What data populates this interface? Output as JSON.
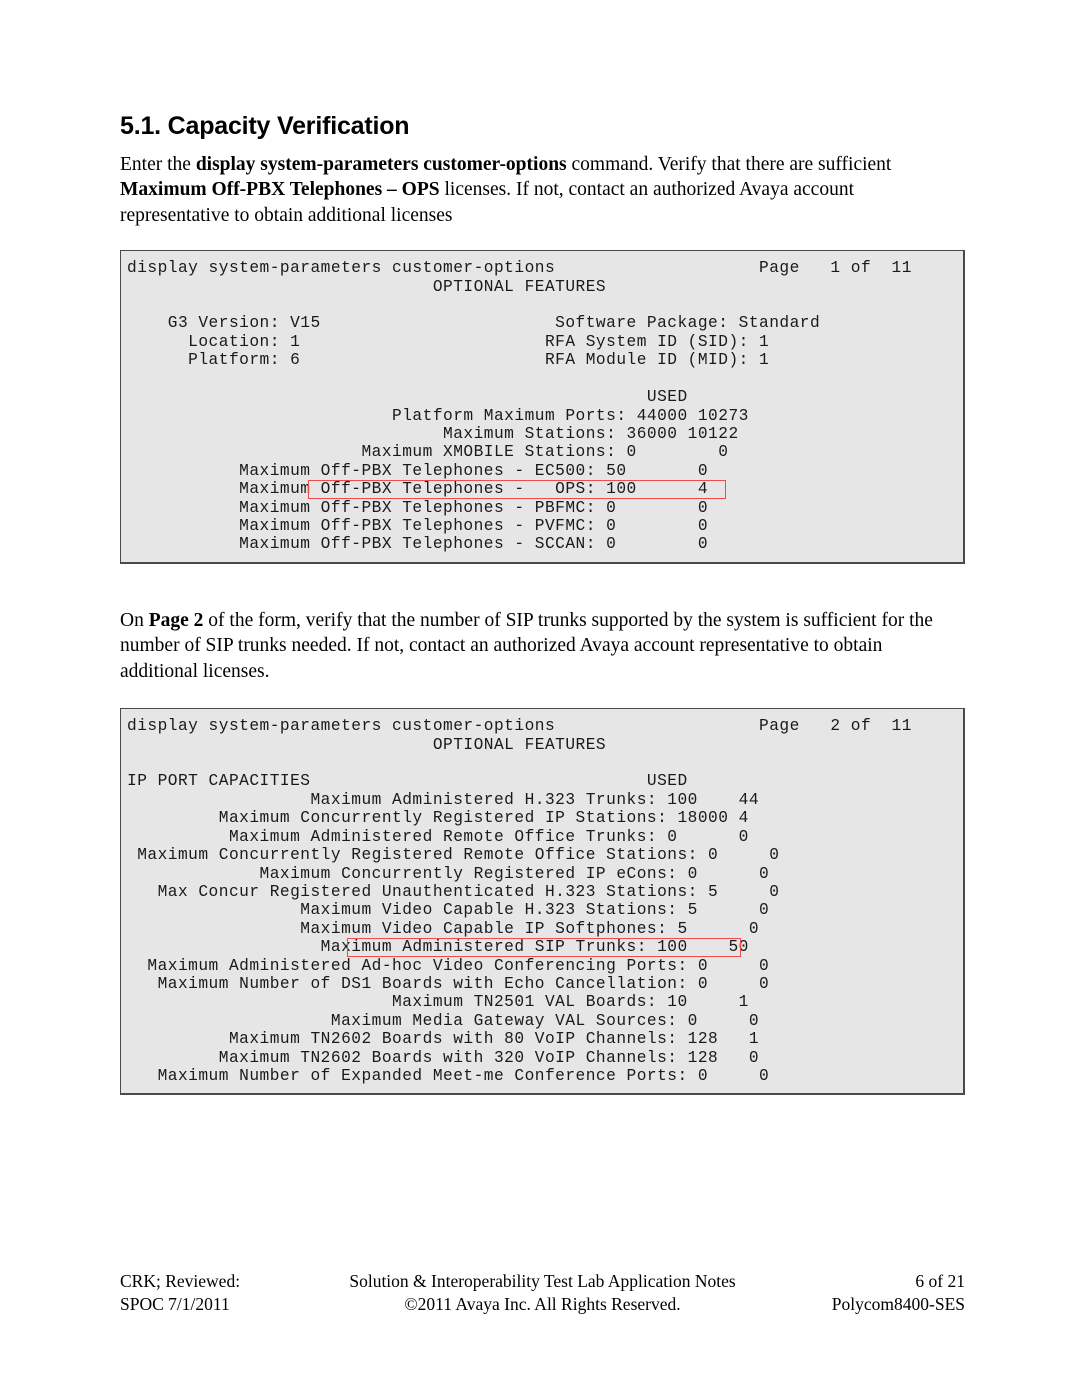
{
  "section": {
    "heading": "5.1. Capacity Verification",
    "paragraph1": {
      "segments": [
        {
          "text": "Enter the ",
          "bold": false
        },
        {
          "text": "display system-parameters customer-options",
          "bold": true
        },
        {
          "text": " command. Verify that there are sufficient ",
          "bold": false
        },
        {
          "text": "Maximum Off-PBX Telephones – OPS",
          "bold": true
        },
        {
          "text": " licenses. If not, contact an authorized Avaya account representative to obtain additional licenses",
          "bold": false
        }
      ]
    },
    "paragraph2": {
      "segments": [
        {
          "text": "On ",
          "bold": false
        },
        {
          "text": "Page 2",
          "bold": true
        },
        {
          "text": " of the form, verify that the number of SIP trunks supported by the system is sufficient for the number of SIP trunks needed. If not, contact an authorized Avaya account representative to obtain additional licenses.",
          "bold": false
        }
      ]
    }
  },
  "terminal1": {
    "name": "system-parameters-customer-options-page-1",
    "highlight_color": "#ee4b4b",
    "background": "#e6e6e6",
    "lines": [
      {
        "text": "display system-parameters customer-options                    Page   1 of  11",
        "boxed": false
      },
      {
        "text": "                              OPTIONAL FEATURES",
        "boxed": false
      },
      {
        "text": "",
        "boxed": false
      },
      {
        "text": "    G3 Version: V15                       Software Package: Standard",
        "boxed": false
      },
      {
        "text": "      Location: 1                        RFA System ID (SID): 1",
        "boxed": false
      },
      {
        "text": "      Platform: 6                        RFA Module ID (MID): 1",
        "boxed": false
      },
      {
        "text": "",
        "boxed": false
      },
      {
        "text": "                                                   USED",
        "boxed": false
      },
      {
        "text": "                          Platform Maximum Ports: 44000 10273",
        "boxed": false
      },
      {
        "text": "                               Maximum Stations: 36000 10122",
        "boxed": false
      },
      {
        "text": "                       Maximum XMOBILE Stations: 0        0",
        "boxed": false
      },
      {
        "text": "           Maximum Off-PBX Telephones - EC500: 50       0",
        "boxed": false
      },
      {
        "text": "           Maximum Off-PBX Telephones -   OPS: 100      4",
        "boxed": true,
        "box": "ops"
      },
      {
        "text": "           Maximum Off-PBX Telephones - PBFMC: 0        0",
        "boxed": false
      },
      {
        "text": "           Maximum Off-PBX Telephones - PVFMC: 0        0",
        "boxed": false
      },
      {
        "text": "           Maximum Off-PBX Telephones - SCCAN: 0        0",
        "boxed": false
      }
    ]
  },
  "terminal2": {
    "name": "system-parameters-customer-options-page-2",
    "highlight_color": "#ee4b4b",
    "background": "#e6e6e6",
    "lines": [
      {
        "text": "display system-parameters customer-options                    Page   2 of  11",
        "boxed": false
      },
      {
        "text": "                              OPTIONAL FEATURES",
        "boxed": false
      },
      {
        "text": "",
        "boxed": false
      },
      {
        "text": "IP PORT CAPACITIES                                 USED",
        "boxed": false
      },
      {
        "text": "                  Maximum Administered H.323 Trunks: 100    44",
        "boxed": false
      },
      {
        "text": "         Maximum Concurrently Registered IP Stations: 18000 4",
        "boxed": false
      },
      {
        "text": "          Maximum Administered Remote Office Trunks: 0      0",
        "boxed": false
      },
      {
        "text": " Maximum Concurrently Registered Remote Office Stations: 0     0",
        "boxed": false
      },
      {
        "text": "             Maximum Concurrently Registered IP eCons: 0      0",
        "boxed": false
      },
      {
        "text": "   Max Concur Registered Unauthenticated H.323 Stations: 5     0",
        "boxed": false
      },
      {
        "text": "                 Maximum Video Capable H.323 Stations: 5      0",
        "boxed": false
      },
      {
        "text": "                 Maximum Video Capable IP Softphones: 5      0",
        "boxed": false
      },
      {
        "text": "                   Maximum Administered SIP Trunks: 100    50",
        "boxed": true,
        "box": "sip"
      },
      {
        "text": "  Maximum Administered Ad-hoc Video Conferencing Ports: 0     0",
        "boxed": false
      },
      {
        "text": "   Maximum Number of DS1 Boards with Echo Cancellation: 0     0",
        "boxed": false
      },
      {
        "text": "                          Maximum TN2501 VAL Boards: 10     1",
        "boxed": false
      },
      {
        "text": "                    Maximum Media Gateway VAL Sources: 0     0",
        "boxed": false
      },
      {
        "text": "          Maximum TN2602 Boards with 80 VoIP Channels: 128   1",
        "boxed": false
      },
      {
        "text": "         Maximum TN2602 Boards with 320 VoIP Channels: 128   0",
        "boxed": false
      },
      {
        "text": "   Maximum Number of Expanded Meet-me Conference Ports: 0     0",
        "boxed": false
      }
    ]
  },
  "footer": {
    "row1": {
      "left": "CRK; Reviewed:",
      "center": "Solution & Interoperability Test Lab Application Notes",
      "right": "6 of 21"
    },
    "row2": {
      "left": "SPOC 7/1/2011",
      "center": "©2011 Avaya Inc. All Rights Reserved.",
      "right": "Polycom8400-SES"
    }
  }
}
